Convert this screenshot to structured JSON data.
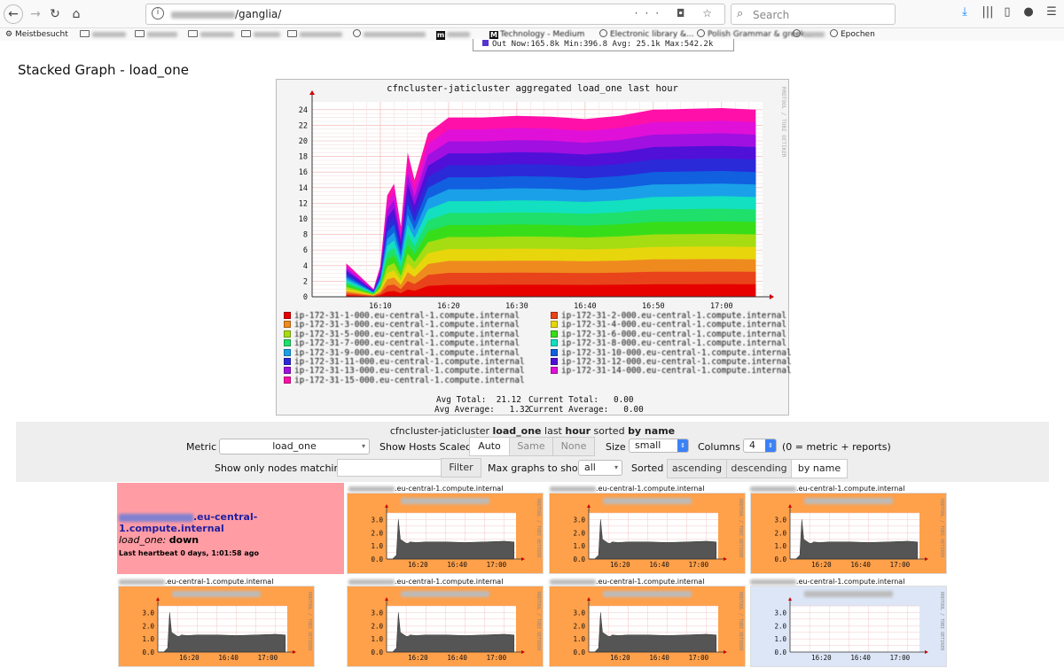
{
  "browser": {
    "url_path": "/ganglia/",
    "search_placeholder": "Search",
    "bookmarks": [
      {
        "label": "Meistbesucht",
        "icon": "gear-icon"
      },
      {
        "label": "Projekte",
        "icon": "folder-icon",
        "blurred": true
      },
      {
        "label": "DevOps",
        "icon": "folder-icon",
        "blurred": true
      },
      {
        "label": "Research",
        "icon": "folder-icon",
        "blurred": true
      },
      {
        "label": "Writing",
        "icon": "folder-icon",
        "blurred": true
      },
      {
        "label": "PhD Program",
        "icon": "folder-icon",
        "blurred": true
      },
      {
        "label": "Lesezeichen",
        "icon": "globe-icon",
        "blurred": true
      },
      {
        "label": "Bridge Activities",
        "icon": "medium-icon",
        "blurred": true
      },
      {
        "label": "Technology - Medium",
        "icon": "medium-icon"
      },
      {
        "label": "Electronic library &...",
        "icon": "globe-icon"
      },
      {
        "label": "Polish Grammar & greek...",
        "icon": "globe-icon"
      },
      {
        "label": "xmas",
        "icon": "globe-icon",
        "blurred": true
      },
      {
        "label": "Epochen",
        "icon": "globe-icon"
      }
    ]
  },
  "peek_bar": {
    "text": "Out   Now:165.8k   Min:396.8   Avg: 25.1k   Max:542.2k"
  },
  "page": {
    "title": "Stacked Graph - load_one"
  },
  "stacked_graph": {
    "title": "cfncluster-jaticluster aggregated load_one last hour",
    "side_text": "RRDTOOL / TOBI OETIKER",
    "legend": [
      {
        "label": "ip-172-31-1-000.eu-central-1.compute.internal",
        "color": "#e60000"
      },
      {
        "label": "ip-172-31-2-000.eu-central-1.compute.internal",
        "color": "#e8431a"
      },
      {
        "label": "ip-172-31-3-000.eu-central-1.compute.internal",
        "color": "#ef8a1f"
      },
      {
        "label": "ip-172-31-4-000.eu-central-1.compute.internal",
        "color": "#e8d60d"
      },
      {
        "label": "ip-172-31-5-000.eu-central-1.compute.internal",
        "color": "#a6dc12"
      },
      {
        "label": "ip-172-31-6-000.eu-central-1.compute.internal",
        "color": "#38dd1a"
      },
      {
        "label": "ip-172-31-7-000.eu-central-1.compute.internal",
        "color": "#1ee06a"
      },
      {
        "label": "ip-172-31-8-000.eu-central-1.compute.internal",
        "color": "#12e0c0"
      },
      {
        "label": "ip-172-31-9-000.eu-central-1.compute.internal",
        "color": "#1aa0e8"
      },
      {
        "label": "ip-172-31-10-000.eu-central-1.compute.internal",
        "color": "#1060e0"
      },
      {
        "label": "ip-172-31-11-000.eu-central-1.compute.internal",
        "color": "#2a2ad8"
      },
      {
        "label": "ip-172-31-12-000.eu-central-1.compute.internal",
        "color": "#5010d8"
      },
      {
        "label": "ip-172-31-13-000.eu-central-1.compute.internal",
        "color": "#a010e0"
      },
      {
        "label": "ip-172-31-14-000.eu-central-1.compute.internal",
        "color": "#e010d8"
      },
      {
        "label": "ip-172-31-15-000.eu-central-1.compute.internal",
        "color": "#ff10a8"
      }
    ],
    "avg_total": "Avg Total:  21.12",
    "current_total": "Current Total:   0.00",
    "avg_average": "Avg Average:   1.32",
    "current_average": "Current Average:   0.00"
  },
  "chart_data": [
    {
      "type": "area",
      "title": "cfncluster-jaticluster aggregated load_one last hour",
      "stacked": true,
      "x_ticks": [
        "16:10",
        "16:20",
        "16:30",
        "16:40",
        "16:50",
        "17:00"
      ],
      "y_ticks": [
        0,
        2,
        4,
        6,
        8,
        10,
        12,
        14,
        16,
        18,
        20,
        22,
        24
      ],
      "ylim": [
        0,
        25
      ],
      "x_minutes": [
        5,
        9,
        10,
        11,
        12,
        13,
        14,
        15,
        17,
        20,
        25,
        30,
        35,
        40,
        45,
        50,
        55,
        60,
        65
      ],
      "total": [
        4.3,
        1.0,
        4.0,
        13.0,
        14.5,
        9.0,
        18.5,
        15.0,
        21.0,
        23.0,
        23.0,
        23.2,
        23.1,
        22.8,
        23.2,
        24.0,
        24.1,
        24.2,
        24.0
      ],
      "series_count": 15,
      "grid": true
    },
    {
      "type": "area",
      "title": "load_one",
      "x_ticks": [
        "16:20",
        "16:40",
        "17:00"
      ],
      "y_ticks": [
        0.0,
        1.0,
        2.0,
        3.0
      ],
      "ylim": [
        0,
        3.5
      ],
      "x_minutes": [
        0,
        3,
        5,
        6,
        7,
        9,
        10,
        11,
        12,
        15,
        20,
        30,
        40,
        50,
        60,
        65
      ],
      "values": [
        0.0,
        0.0,
        0.3,
        3.0,
        1.5,
        1.3,
        1.2,
        1.2,
        1.3,
        1.25,
        1.3,
        1.3,
        1.25,
        1.3,
        1.35,
        1.3
      ]
    }
  ],
  "controls": {
    "heading_prefix": "cfncluster-jaticluster",
    "heading_metric": "load_one",
    "heading_last": "last",
    "heading_range": "hour",
    "heading_sorted": "sorted",
    "heading_by": "by name",
    "metric_label": "Metric",
    "metric_value": "load_one",
    "scaled_label": "Show Hosts Scaled:",
    "scaled_options": [
      "Auto",
      "Same",
      "None"
    ],
    "size_label": "Size",
    "size_value": "small",
    "columns_label": "Columns",
    "columns_value": "4",
    "columns_note": "(0 = metric + reports)",
    "filter_label": "Show only nodes matching",
    "filter_button": "Filter",
    "max_label": "Max graphs to show",
    "max_value": "all",
    "sorted_label": "Sorted",
    "sort_options": [
      "ascending",
      "descending",
      "by name"
    ]
  },
  "down_host": {
    "host_suffix": ".eu-central-1.compute.internal",
    "metric": "load_one:",
    "status": "down",
    "heartbeat": "Last heartbeat 0 days, 1:01:58 ago"
  },
  "tiles": {
    "host_suffix": ".eu-central-1.compute.internal",
    "y_ticks": [
      "3.0",
      "2.0",
      "1.0",
      "0.0"
    ],
    "x_ticks": [
      "16:20",
      "16:40",
      "17:00"
    ],
    "side_text": "RRDTOOL / TOBI OETIKER"
  }
}
